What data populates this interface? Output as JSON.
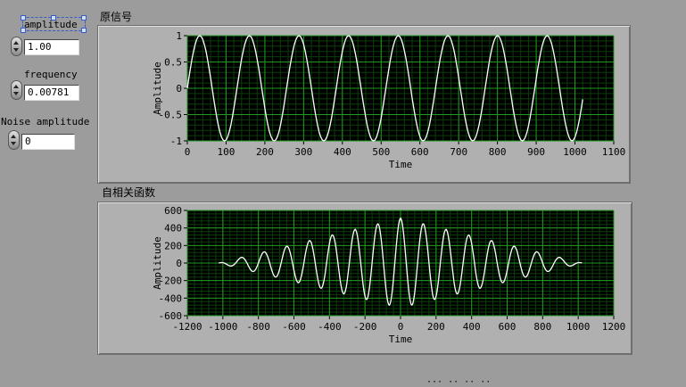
{
  "controls": {
    "amplitude": {
      "label": "amplitude",
      "value": "1.00"
    },
    "frequency": {
      "label": "frequency",
      "value": "0.00781"
    },
    "noise": {
      "label": "Noise amplitude",
      "value": "0"
    }
  },
  "graphs": {
    "original_title": "原信号",
    "autocorr_title": "自相关函数"
  },
  "colors": {
    "plot_bg": "#000000",
    "grid_major": "#1f9a1f",
    "grid_minor": "#0b3d0b",
    "trace": "#ffffff"
  },
  "chart_data": [
    {
      "type": "line",
      "title": "原信号",
      "xlabel": "Time",
      "ylabel": "Amplitude",
      "xlim": [
        0,
        1100
      ],
      "ylim": [
        -1,
        1
      ],
      "xticks": [
        "0",
        "100",
        "200",
        "300",
        "400",
        "500",
        "600",
        "700",
        "800",
        "900",
        "1000",
        "1100"
      ],
      "yticks": [
        "1",
        "0.5",
        "0",
        "-0.5",
        "-1"
      ],
      "series": [
        {
          "function": "sine",
          "amplitude": 1.0,
          "frequency": 0.00781,
          "x_start": 0,
          "x_end": 1023,
          "step": 4
        }
      ],
      "grid": true
    },
    {
      "type": "line",
      "title": "自相关函数",
      "xlabel": "Time",
      "ylabel": "Amplitude",
      "xlim": [
        -1200,
        1200
      ],
      "ylim": [
        -600,
        600
      ],
      "xticks": [
        "-1200",
        "-1000",
        "-800",
        "-600",
        "-400",
        "-200",
        "0",
        "200",
        "400",
        "600",
        "800",
        "1000",
        "1200"
      ],
      "yticks": [
        "600",
        "400",
        "200",
        "0",
        "-200",
        "-400",
        "-600"
      ],
      "series": [
        {
          "function": "autocorrelation_of_sine",
          "amplitude": 1.0,
          "frequency": 0.00781,
          "n": 1024,
          "peak": 512,
          "x_start": -1023,
          "x_end": 1023,
          "step": 4
        }
      ],
      "grid": true
    }
  ],
  "bottom_text": "··· ·· ·· ··"
}
